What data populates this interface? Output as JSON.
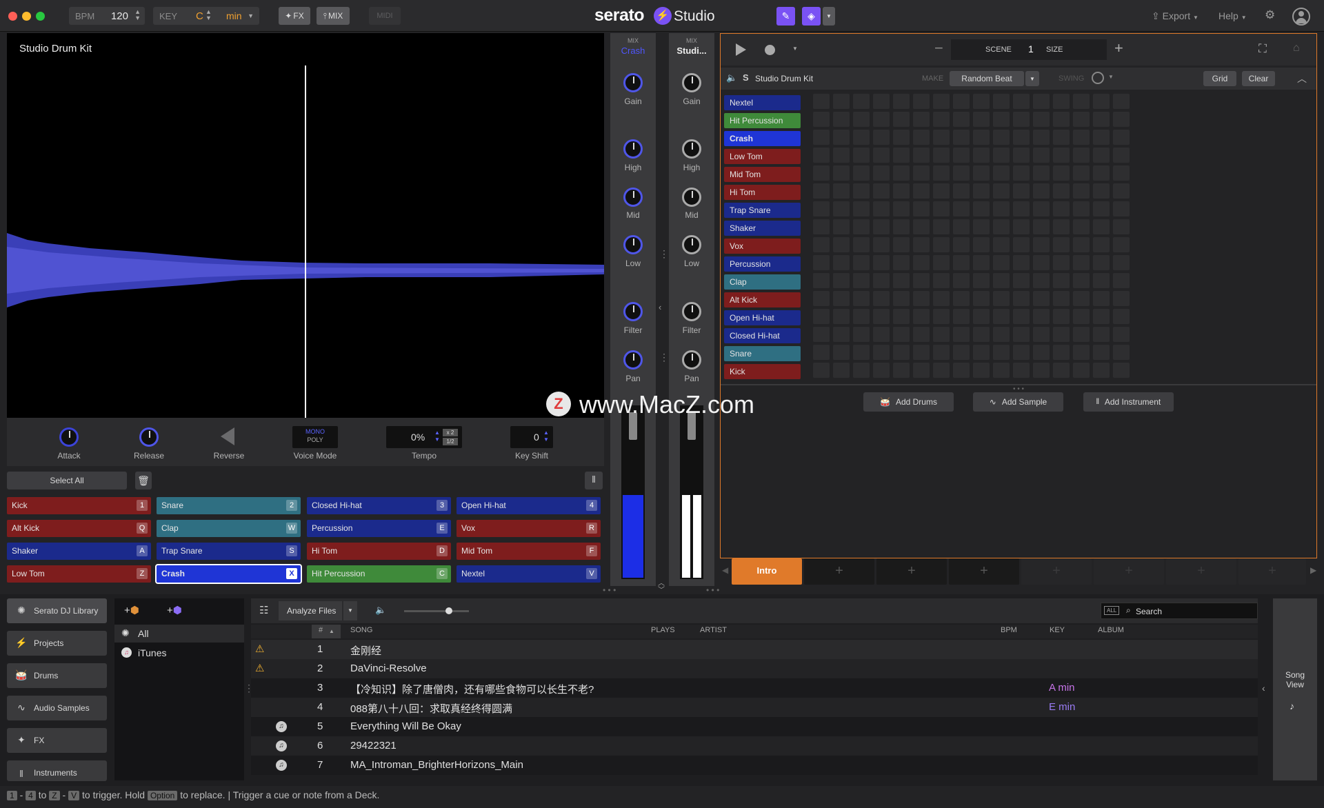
{
  "topbar": {
    "bpm_label": "BPM",
    "bpm_value": "120",
    "key_label": "KEY",
    "key_value": "C",
    "key_mode": "min",
    "fx_label": "FX",
    "mix_label": "MIX",
    "midi_label": "MIDI",
    "logo_serato": "serato",
    "logo_studio": "Studio",
    "export_label": "Export",
    "help_label": "Help"
  },
  "sampler": {
    "title": "Studio Drum Kit",
    "controls": {
      "attack": "Attack",
      "release": "Release",
      "reverse": "Reverse",
      "voice_mode": "Voice Mode",
      "voice_mono": "MONO",
      "voice_poly": "POLY",
      "tempo": "Tempo",
      "tempo_value": "0%",
      "tempo_x2": "x 2",
      "tempo_half": "1/2",
      "key_shift": "Key Shift",
      "key_shift_value": "0"
    },
    "select_all": "Select All",
    "pads": [
      {
        "name": "Kick",
        "key": "1"
      },
      {
        "name": "Snare",
        "key": "2"
      },
      {
        "name": "Closed Hi-hat",
        "key": "3"
      },
      {
        "name": "Open Hi-hat",
        "key": "4"
      },
      {
        "name": "Alt Kick",
        "key": "Q"
      },
      {
        "name": "Clap",
        "key": "W"
      },
      {
        "name": "Percussion",
        "key": "E"
      },
      {
        "name": "Vox",
        "key": "R"
      },
      {
        "name": "Shaker",
        "key": "A"
      },
      {
        "name": "Trap Snare",
        "key": "S"
      },
      {
        "name": "Hi Tom",
        "key": "D"
      },
      {
        "name": "Mid Tom",
        "key": "F"
      },
      {
        "name": "Low Tom",
        "key": "Z"
      },
      {
        "name": "Crash",
        "key": "X"
      },
      {
        "name": "Hit Percussion",
        "key": "C"
      },
      {
        "name": "Nextel",
        "key": "V"
      }
    ]
  },
  "mixer": {
    "strip1": {
      "top": "MIX",
      "name": "Crash"
    },
    "strip2": {
      "top": "MIX",
      "name": "Studi..."
    },
    "knobs": [
      "Gain",
      "High",
      "Mid",
      "Low",
      "Filter",
      "Pan"
    ]
  },
  "sequencer": {
    "scene_label": "SCENE",
    "scene_value": "1",
    "size_label": "SIZE",
    "track_name": "Studio Drum Kit",
    "track_letter": "S",
    "make_label": "MAKE",
    "random_beat": "Random Beat",
    "swing_label": "SWING",
    "grid_btn": "Grid",
    "clear_btn": "Clear",
    "labels": [
      "Nextel",
      "Hit Percussion",
      "Crash",
      "Low Tom",
      "Mid Tom",
      "Hi Tom",
      "Trap Snare",
      "Shaker",
      "Vox",
      "Percussion",
      "Clap",
      "Alt Kick",
      "Open Hi-hat",
      "Closed Hi-hat",
      "Snare",
      "Kick"
    ],
    "add_drums": "Add Drums",
    "add_sample": "Add Sample",
    "add_instrument": "Add Instrument",
    "scene_intro": "Intro",
    "plus": "+"
  },
  "watermark": "www.MacZ.com",
  "watermark_letter": "Z",
  "library": {
    "sidebar": [
      "Serato DJ Library",
      "Projects",
      "Drums",
      "Audio Samples",
      "FX",
      "Instruments"
    ],
    "crates": [
      "All",
      "iTunes"
    ],
    "analyze": "Analyze Files",
    "search_all": "ALL",
    "search_placeholder": "Search",
    "columns": {
      "num": "#",
      "song": "SONG",
      "plays": "PLAYS",
      "artist": "ARTIST",
      "bpm": "BPM",
      "key": "KEY",
      "album": "ALBUM"
    },
    "rows": [
      {
        "num": "1",
        "song": "金刚经",
        "key": ""
      },
      {
        "num": "2",
        "song": "DaVinci-Resolve",
        "key": ""
      },
      {
        "num": "3",
        "song": "【冷知识】除了唐僧肉，还有哪些食物可以长生不老?",
        "key": "A min"
      },
      {
        "num": "4",
        "song": "088第八十八回：求取真经终得圆满",
        "key": "E min"
      },
      {
        "num": "5",
        "song": "Everything Will Be Okay",
        "key": ""
      },
      {
        "num": "6",
        "song": "29422321",
        "key": ""
      },
      {
        "num": "7",
        "song": "MA_Introman_BrighterHorizons_Main",
        "key": ""
      }
    ],
    "song_view": "Song\nView"
  },
  "status": {
    "k1": "1",
    "dash": "-",
    "k4": "4",
    "to1": "to",
    "kz": "Z",
    "kv": "V",
    "t1": "to trigger. Hold",
    "option": "Option",
    "t2": "to replace. | Trigger a cue or note from a Deck."
  }
}
